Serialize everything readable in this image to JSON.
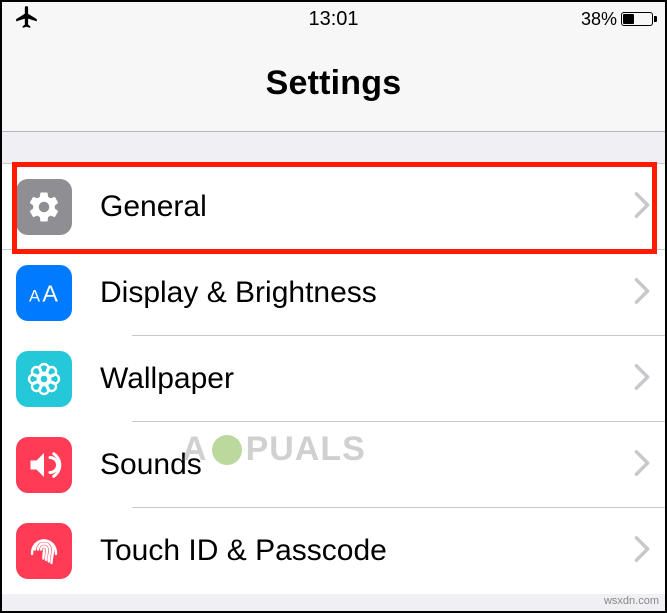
{
  "status": {
    "time": "13:01",
    "battery_pct": "38%"
  },
  "header": {
    "title": "Settings"
  },
  "rows": [
    {
      "key": "general",
      "label": "General"
    },
    {
      "key": "display",
      "label": "Display & Brightness"
    },
    {
      "key": "wallpaper",
      "label": "Wallpaper"
    },
    {
      "key": "sounds",
      "label": "Sounds"
    },
    {
      "key": "touchid",
      "label": "Touch ID & Passcode"
    }
  ],
  "watermark": {
    "prefix": "A",
    "suffix": "PUALS"
  },
  "source_tag": "wsxdn.com"
}
